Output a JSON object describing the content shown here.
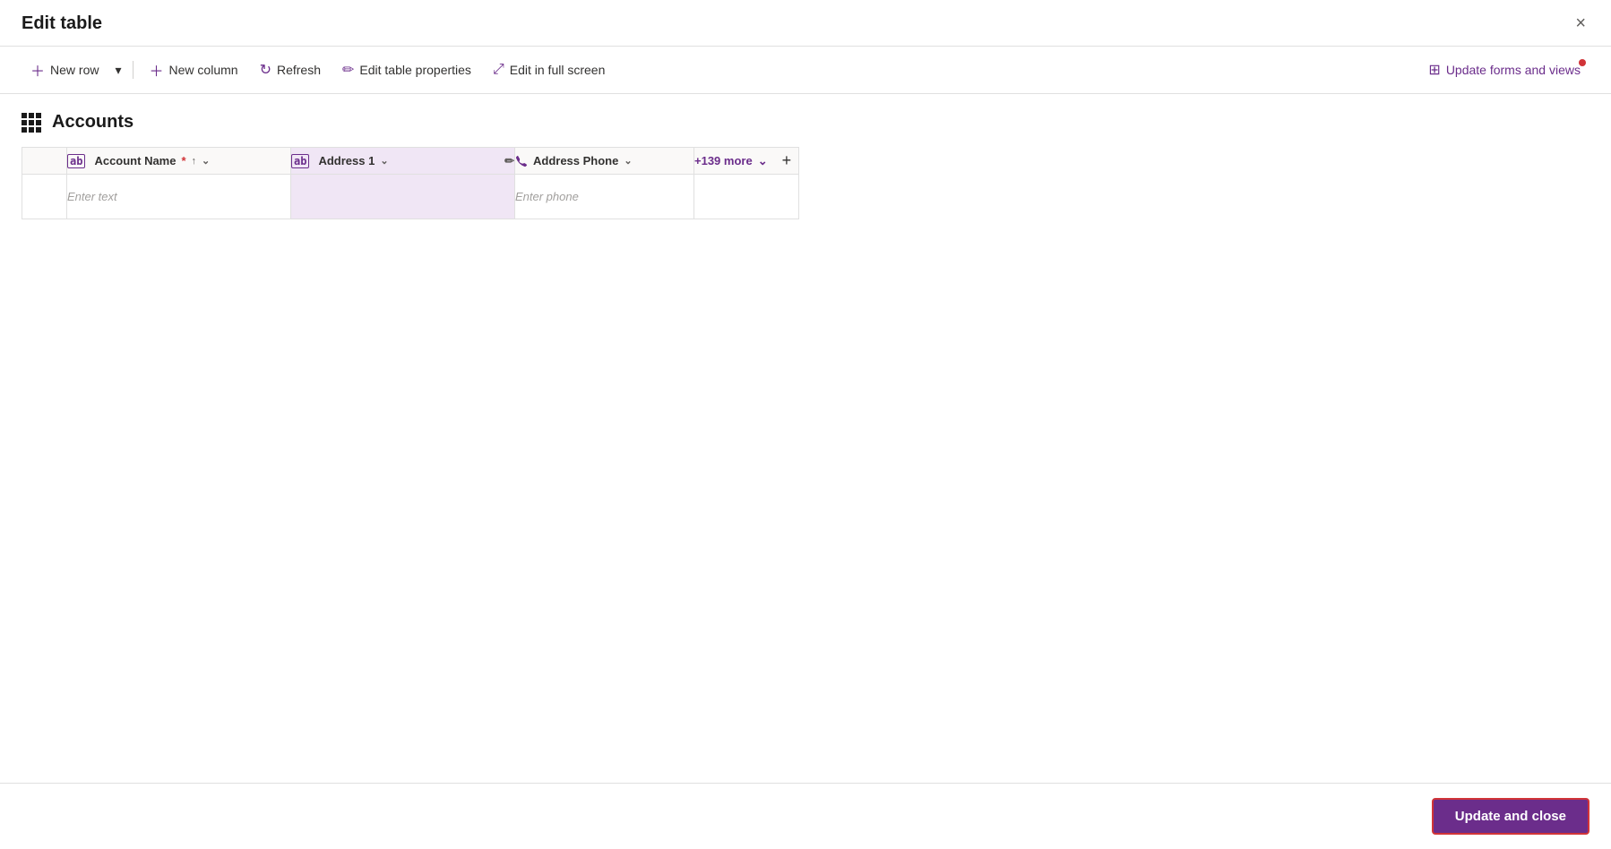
{
  "modal": {
    "title": "Edit table",
    "close_label": "×"
  },
  "toolbar": {
    "new_row_label": "New row",
    "new_column_label": "New column",
    "refresh_label": "Refresh",
    "edit_table_properties_label": "Edit table properties",
    "edit_in_full_screen_label": "Edit in full screen",
    "update_forms_label": "Update forms and views"
  },
  "table": {
    "heading": "Accounts",
    "columns": [
      {
        "id": "account_name",
        "label": "Account Name",
        "required": true,
        "type": "text",
        "sortable": true,
        "placeholder": "Enter text"
      },
      {
        "id": "address1",
        "label": "Address 1",
        "required": false,
        "type": "text",
        "selected": true,
        "placeholder": ""
      },
      {
        "id": "address_phone",
        "label": "Address Phone",
        "required": false,
        "type": "phone",
        "placeholder": "Enter phone"
      }
    ],
    "more_columns_label": "+139 more",
    "add_column_label": "+"
  },
  "footer": {
    "update_close_label": "Update and close"
  }
}
